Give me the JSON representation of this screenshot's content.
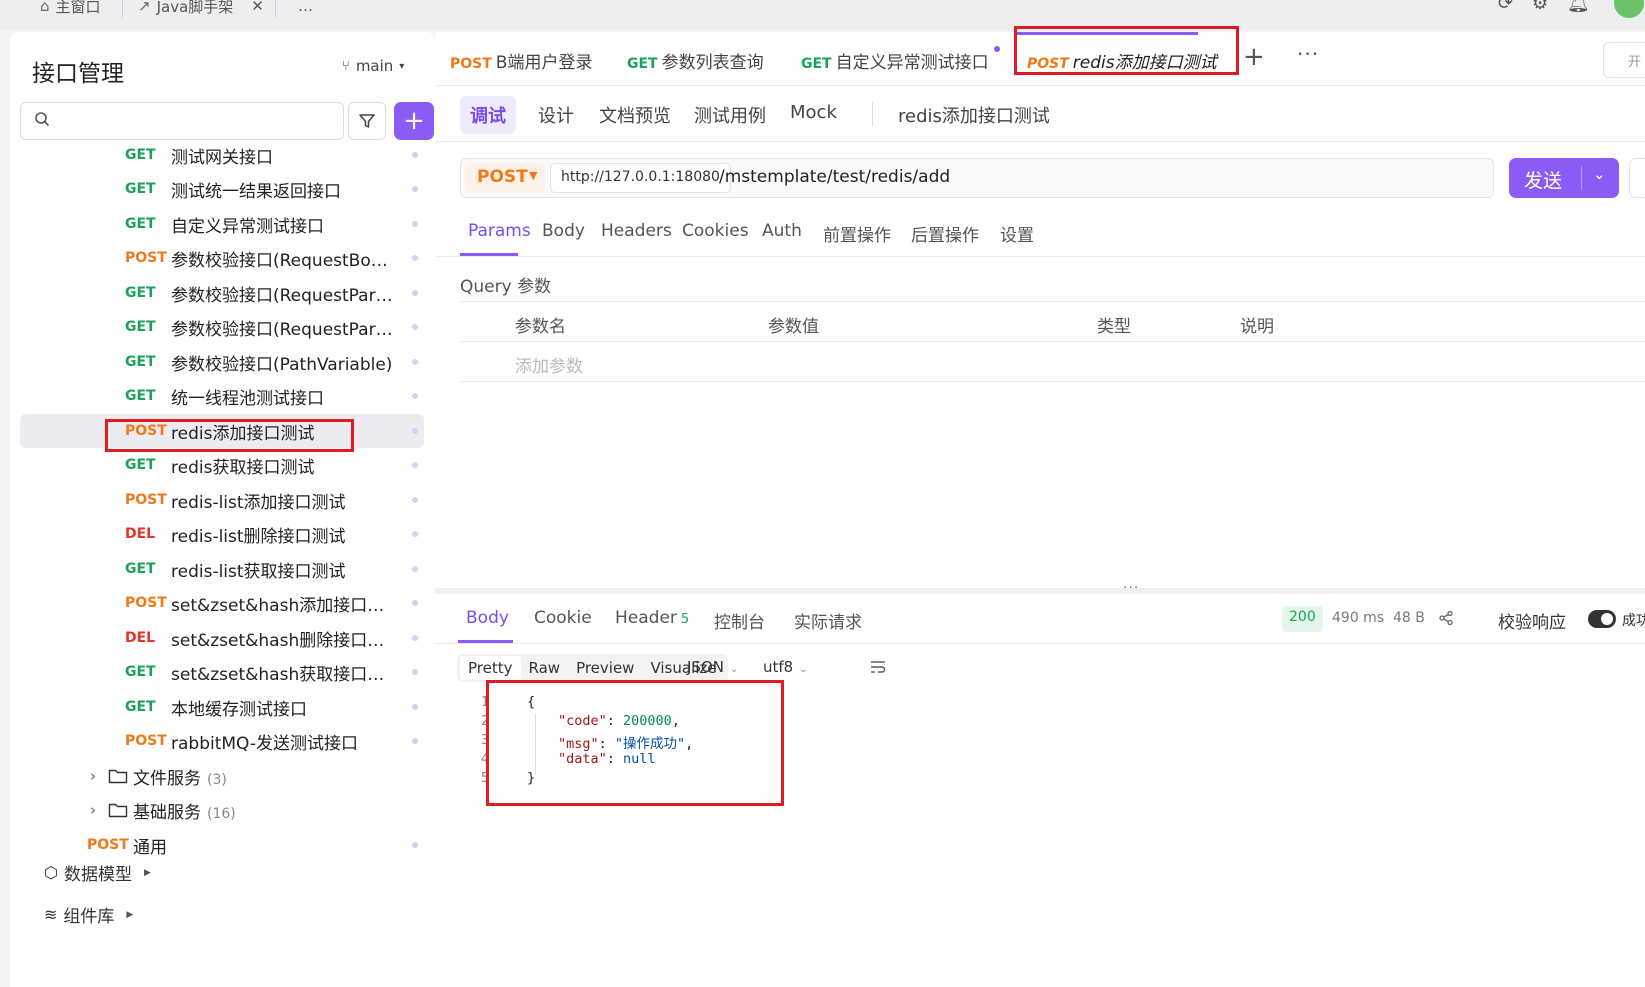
{
  "window": {
    "tabs": [
      {
        "label": "主窗口"
      },
      {
        "label": "Java脚手架"
      }
    ],
    "more": "…"
  },
  "sidebar": {
    "title": "接口管理",
    "branch": "main",
    "search": {
      "placeholder": "",
      "value": ""
    },
    "apis": [
      {
        "method": "GET",
        "name": "测试网关接口"
      },
      {
        "method": "GET",
        "name": "测试统一结果返回接口"
      },
      {
        "method": "GET",
        "name": "自定义异常测试接口"
      },
      {
        "method": "POST",
        "name": "参数校验接口(RequestBody)"
      },
      {
        "method": "GET",
        "name": "参数校验接口(RequestPara..."
      },
      {
        "method": "GET",
        "name": "参数校验接口(RequestPara..."
      },
      {
        "method": "GET",
        "name": "参数校验接口(PathVariable)"
      },
      {
        "method": "GET",
        "name": "统一线程池测试接口"
      },
      {
        "method": "POST",
        "name": "redis添加接口测试"
      },
      {
        "method": "GET",
        "name": "redis获取接口测试"
      },
      {
        "method": "POST",
        "name": "redis-list添加接口测试"
      },
      {
        "method": "DEL",
        "name": "redis-list删除接口测试"
      },
      {
        "method": "GET",
        "name": "redis-list获取接口测试"
      },
      {
        "method": "POST",
        "name": "set&zset&hash添加接口测试"
      },
      {
        "method": "DEL",
        "name": "set&zset&hash删除接口测试"
      },
      {
        "method": "GET",
        "name": "set&zset&hash获取接口测试"
      },
      {
        "method": "GET",
        "name": "本地缓存测试接口"
      },
      {
        "method": "POST",
        "name": "rabbitMQ-发送测试接口"
      }
    ],
    "folders": [
      {
        "name": "文件服务",
        "count": "(3)"
      },
      {
        "name": "基础服务",
        "count": "(16)"
      }
    ],
    "general": {
      "method": "POST",
      "name": "通用"
    },
    "data_model": "数据模型",
    "component_lib": "组件库"
  },
  "request_tabs": [
    {
      "method": "POST",
      "name": "B端用户登录"
    },
    {
      "method": "GET",
      "name": "参数列表查询"
    },
    {
      "method": "GET",
      "name": "自定义异常测试接口"
    },
    {
      "method": "POST",
      "name": "redis添加接口测试"
    }
  ],
  "request_tabs_right": "开",
  "sub_tabs": {
    "items": [
      "调试",
      "设计",
      "文档预览",
      "测试用例",
      "Mock"
    ],
    "api_title": "redis添加接口测试"
  },
  "url_bar": {
    "method": "POST",
    "base_url": "http://127.0.0.1:18080",
    "path": "/mstemplate/test/redis/add",
    "send_label": "发送"
  },
  "param_tabs": [
    "Params",
    "Body",
    "Headers",
    "Cookies",
    "Auth",
    "前置操作",
    "后置操作",
    "设置"
  ],
  "query": {
    "label": "Query 参数",
    "columns": [
      "参数名",
      "参数值",
      "类型",
      "说明"
    ],
    "add_placeholder": "添加参数"
  },
  "response": {
    "tabs": [
      {
        "label": "Body",
        "badge": ""
      },
      {
        "label": "Cookie",
        "badge": ""
      },
      {
        "label": "Header",
        "badge": "5"
      },
      {
        "label": "控制台",
        "badge": ""
      },
      {
        "label": "实际请求",
        "badge": ""
      }
    ],
    "status": "200",
    "time": "490 ms",
    "size": "48 B",
    "validate_label": "校验响应",
    "validate_result": "成功",
    "formats": [
      "Pretty",
      "Raw",
      "Preview",
      "Visualize"
    ],
    "content_type": "JSON",
    "encoding": "utf8",
    "body_lines": [
      {
        "no": "1",
        "text": "{"
      },
      {
        "no": "2",
        "key": "\"code\"",
        "value": "200000",
        "vtype": "num",
        "trail": ","
      },
      {
        "no": "3",
        "key": "\"msg\"",
        "value": "\"操作成功\"",
        "vtype": "str",
        "trail": ","
      },
      {
        "no": "4",
        "key": "\"data\"",
        "value": "null",
        "vtype": "kw",
        "trail": ""
      },
      {
        "no": "5",
        "text": "}"
      }
    ]
  },
  "colors": {
    "accent": "#8a5cf5",
    "get": "#19a35a",
    "post": "#f07a1a",
    "del": "#e5352b",
    "highlight_box": "#e01b22"
  }
}
